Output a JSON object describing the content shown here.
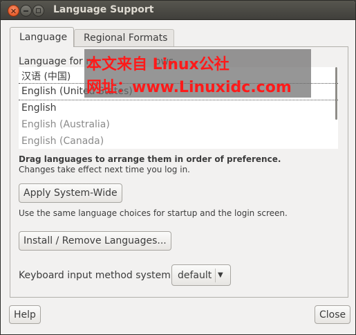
{
  "window": {
    "title": "Language Support",
    "buttons": {
      "close_icon": "close-icon",
      "minimize_icon": "minimize-icon",
      "maximize_icon": "maximize-icon"
    }
  },
  "tabs": [
    {
      "label": "Language",
      "active": true
    },
    {
      "label": "Regional Formats",
      "active": false
    }
  ],
  "language_list": {
    "label": "Language for m",
    "label_tail": "ows",
    "items": [
      {
        "text": "汉语 (中国)",
        "dotted": true,
        "greyed": false
      },
      {
        "text": "English (United States)",
        "dotted": true,
        "greyed": false
      },
      {
        "text": "English",
        "dotted": false,
        "greyed": false
      },
      {
        "text": "English (Australia)",
        "dotted": false,
        "greyed": true
      },
      {
        "text": "English (Canada)",
        "dotted": false,
        "greyed": true
      }
    ]
  },
  "hints": {
    "drag": "Drag languages to arrange them in order of preference.",
    "changes": "Changes take effect next time you log in."
  },
  "apply_button": "Apply System-Wide",
  "apply_note": "Use the same language choices for startup and the login screen.",
  "install_button": "Install / Remove Languages...",
  "keyboard": {
    "label": "Keyboard input method system:",
    "value": "default",
    "arrow_icon": "dropdown-arrow-icon"
  },
  "footer": {
    "help": "Help",
    "close": "Close"
  },
  "watermark": {
    "line1": "本文来自 Linux公社",
    "line2": "网址：www.Linuxidc.com",
    "color": "#ff1a1a"
  },
  "colors": {
    "titlebar": "#403f3b",
    "window_bg": "#f2f1f0",
    "close_button": "#df4a16"
  }
}
